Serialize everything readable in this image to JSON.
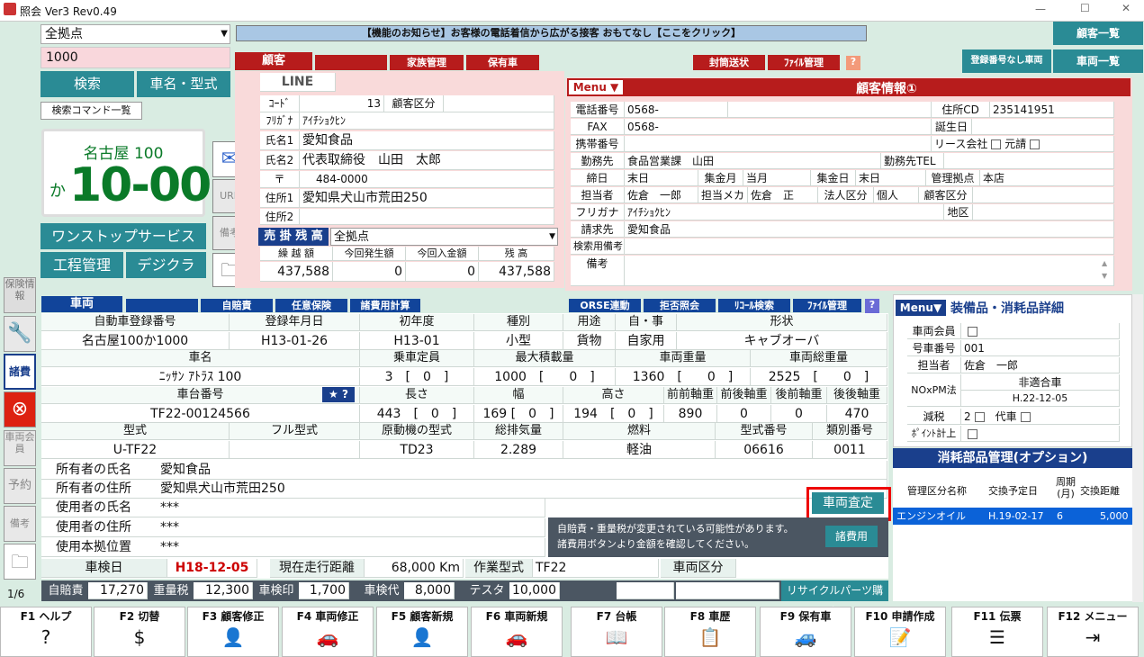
{
  "title": "照会 Ver3 Rev0.49",
  "win": {
    "min": "—",
    "max": "☐",
    "close": "✕"
  },
  "search": {
    "location": "全拠点",
    "query": "1000",
    "btn_search": "検索",
    "btn_model": "車名・型式",
    "btn_cmd": "検索コマンド一覧"
  },
  "plate": {
    "region": "名古屋 100",
    "kana": "か",
    "number": "10-00"
  },
  "side_buttons": {
    "one_stop": "ワンストップサービス",
    "process": "工程管理",
    "digi": "デジクラ",
    "url": "URL",
    "memo": "備考"
  },
  "notice": "【機能のお知らせ】お客様の電話着信から広がる接客 おもてなし【ここをクリック】",
  "right_buttons": {
    "cust_list": "顧客一覧",
    "reg_none": "登録番号なし車両",
    "veh_list": "車両一覧"
  },
  "cust_tabs": {
    "customer": "顧客",
    "family": "家族管理",
    "owned": "保有車",
    "envelope": "封筒送状",
    "file": "ﾌｧｲﾙ管理",
    "q": "?"
  },
  "cust": {
    "line": "LINE",
    "code_l": "ｺｰﾄﾞ",
    "code": "13",
    "kubun_l": "顧客区分",
    "furi_l": "ﾌﾘｶﾞﾅ",
    "furi": "ｱｲﾁｼｮｸﾋﾝ",
    "name1_l": "氏名1",
    "name1": "愛知食品",
    "name2_l": "氏名2",
    "name2": "代表取締役　山田　太郎",
    "zip_l": "〒",
    "zip": "484-0000",
    "addr1_l": "住所1",
    "addr1": "愛知県犬山市荒田250",
    "addr2_l": "住所2"
  },
  "ar": {
    "title": "売 掛 残 高",
    "loc": "全拠点",
    "h_carry": "繰 越 額",
    "h_new": "今回発生額",
    "h_pay": "今回入金額",
    "h_bal": "残 高",
    "carry": "437,588",
    "new": "0",
    "pay": "0",
    "bal": "437,588"
  },
  "info": {
    "menu": "Menu ▼",
    "title": "顧客情報①",
    "tel_l": "電話番号",
    "tel": "0568-",
    "fax_l": "FAX",
    "fax": "0568-",
    "mobile_l": "携帯番号",
    "addrcd_l": "住所CD",
    "addrcd": "235141951",
    "birth_l": "誕生日",
    "lease_l": "リース会社",
    "motoukai_l": "元請",
    "work_l": "勤務先",
    "work": "食品営業課　山田",
    "worktel_l": "勤務先TEL",
    "close_l": "締日",
    "close": "末日",
    "coll_m_l": "集金月",
    "coll_m": "当月",
    "coll_d_l": "集金日",
    "coll_d": "末日",
    "base_l": "管理拠点",
    "base": "本店",
    "staff_l": "担当者",
    "staff": "佐倉　一郎",
    "maker_l": "担当メカ",
    "maker": "佐倉　正",
    "corp_l": "法人区分",
    "corp": "個人",
    "ckubun_l": "顧客区分",
    "furi2_l": "フリガナ",
    "furi2": "ｱｲﾁｼｮｸﾋﾝ",
    "area_l": "地区",
    "bill_l": "請求先",
    "bill": "愛知食品",
    "srch_l": "検索用備考",
    "memo_l": "備考"
  },
  "veh_tabs": {
    "veh": "車両",
    "jibai": "自賠責",
    "nini": "任意保険",
    "shohi": "諸費用計算",
    "orse": "ORSE連動",
    "kyohi": "拒否照会",
    "recall": "ﾘｺｰﾙ検索",
    "file": "ﾌｧｲﾙ管理",
    "q": "?"
  },
  "veh": {
    "h1": [
      "自動車登録番号",
      "登録年月日",
      "初年度",
      "種別",
      "用途",
      "自・事",
      "形状"
    ],
    "r1": [
      "名古屋100か1000",
      "H13-01-26",
      "H13-01",
      "小型",
      "貨物",
      "自家用",
      "キャブオーバ"
    ],
    "h2": [
      "車名",
      "乗車定員",
      "最大積載量",
      "車両重量",
      "車両総重量"
    ],
    "r2": [
      "ﾆｯｻﾝ ｱﾄﾗｽ 100",
      "3　[　0　]",
      "1000　[　　0　]",
      "1360　[　　0　]",
      "2525　[　　0　]"
    ],
    "h3": [
      "車台番号",
      "長さ",
      "幅",
      "高さ",
      "前前軸重",
      "前後軸重",
      "後前軸重",
      "後後軸重"
    ],
    "r3": [
      "TF22-00124566",
      "443　[　0　]",
      "169 [　0　]",
      "194　[　0　]",
      "890",
      "0",
      "0",
      "470"
    ],
    "h4": [
      "型式",
      "フル型式",
      "原動機の型式",
      "総排気量",
      "燃料",
      "型式番号",
      "類別番号"
    ],
    "r4": [
      "U-TF22",
      "",
      "TD23",
      "2.289",
      "軽油",
      "06616",
      "0011"
    ],
    "owner_l": "所有者の氏名",
    "owner": "愛知食品",
    "oaddr_l": "所有者の住所",
    "oaddr": "愛知県犬山市荒田250",
    "user_l": "使用者の氏名",
    "user": "***",
    "uaddr_l": "使用者の住所",
    "uaddr": "***",
    "loc_l": "使用本拠位置",
    "loc": "***",
    "shaken_l": "車検日",
    "shaken": "H18-12-05",
    "mileage_l": "現在走行距離",
    "mileage": "68,000 Km",
    "worktype_l": "作業型式",
    "worktype": "TF22",
    "vkubun_l": "車両区分",
    "satei": "車両査定"
  },
  "tooltip": {
    "line1": "自賠責・重量税が変更されている可能性があります。",
    "line2": "諸費用ボタンより金額を確認してください。",
    "btn": "諸費用"
  },
  "fees": {
    "jibai_l": "自賠責",
    "jibai": "17,270",
    "jyuryo_l": "重量税",
    "jyuryo": "12,300",
    "in_l": "車検印",
    "in": "1,700",
    "dai_l": "車検代",
    "dai": "8,000",
    "tester_l": "テスタ",
    "tester": "10,000",
    "recycle": "リサイクルパーツ購入"
  },
  "equip": {
    "menu": "Menu▼",
    "title": "装備品・消耗品詳細",
    "kaiin_l": "車両会員",
    "gosha_l": "号車番号",
    "gosha": "001",
    "staff_l": "担当者",
    "staff": "佐倉　一郎",
    "nox_l": "NOxPM法",
    "nox1": "非適合車",
    "nox2": "H.22-12-05",
    "genzei_l": "減税",
    "genzei": "2",
    "daisha_l": "代車",
    "point_l": "ﾎﾟｲﾝﾄ計上"
  },
  "parts": {
    "title": "消耗部品管理(オプション)",
    "h": [
      "管理区分名称",
      "交換予定日",
      "周期(月)",
      "交換距離"
    ],
    "row": [
      "エンジンオイル",
      "H.19-02-17",
      "6",
      "5,000"
    ]
  },
  "sidebar": {
    "hoken": "保険情報",
    "shohi": "諸費",
    "kaiin": "車両会員",
    "yoyaku": "予約",
    "biko": "備考",
    "page": "1/6"
  },
  "fkeys": [
    {
      "k": "F1 ヘルプ",
      "i": "?"
    },
    {
      "k": "F2 切替",
      "i": "$"
    },
    {
      "k": "F3 顧客修正",
      "i": "👤"
    },
    {
      "k": "F4 車両修正",
      "i": "🚗"
    },
    {
      "k": "F5 顧客新規",
      "i": "👤"
    },
    {
      "k": "F6 車両新規",
      "i": "🚗"
    },
    {
      "k": "F7 台帳",
      "i": "📖"
    },
    {
      "k": "F8 車歴",
      "i": "📋"
    },
    {
      "k": "F9 保有車",
      "i": "🚙"
    },
    {
      "k": "F10 申請作成",
      "i": "📝"
    },
    {
      "k": "F11 伝票",
      "i": "☰"
    },
    {
      "k": "F12 メニュー",
      "i": "⇥"
    }
  ]
}
